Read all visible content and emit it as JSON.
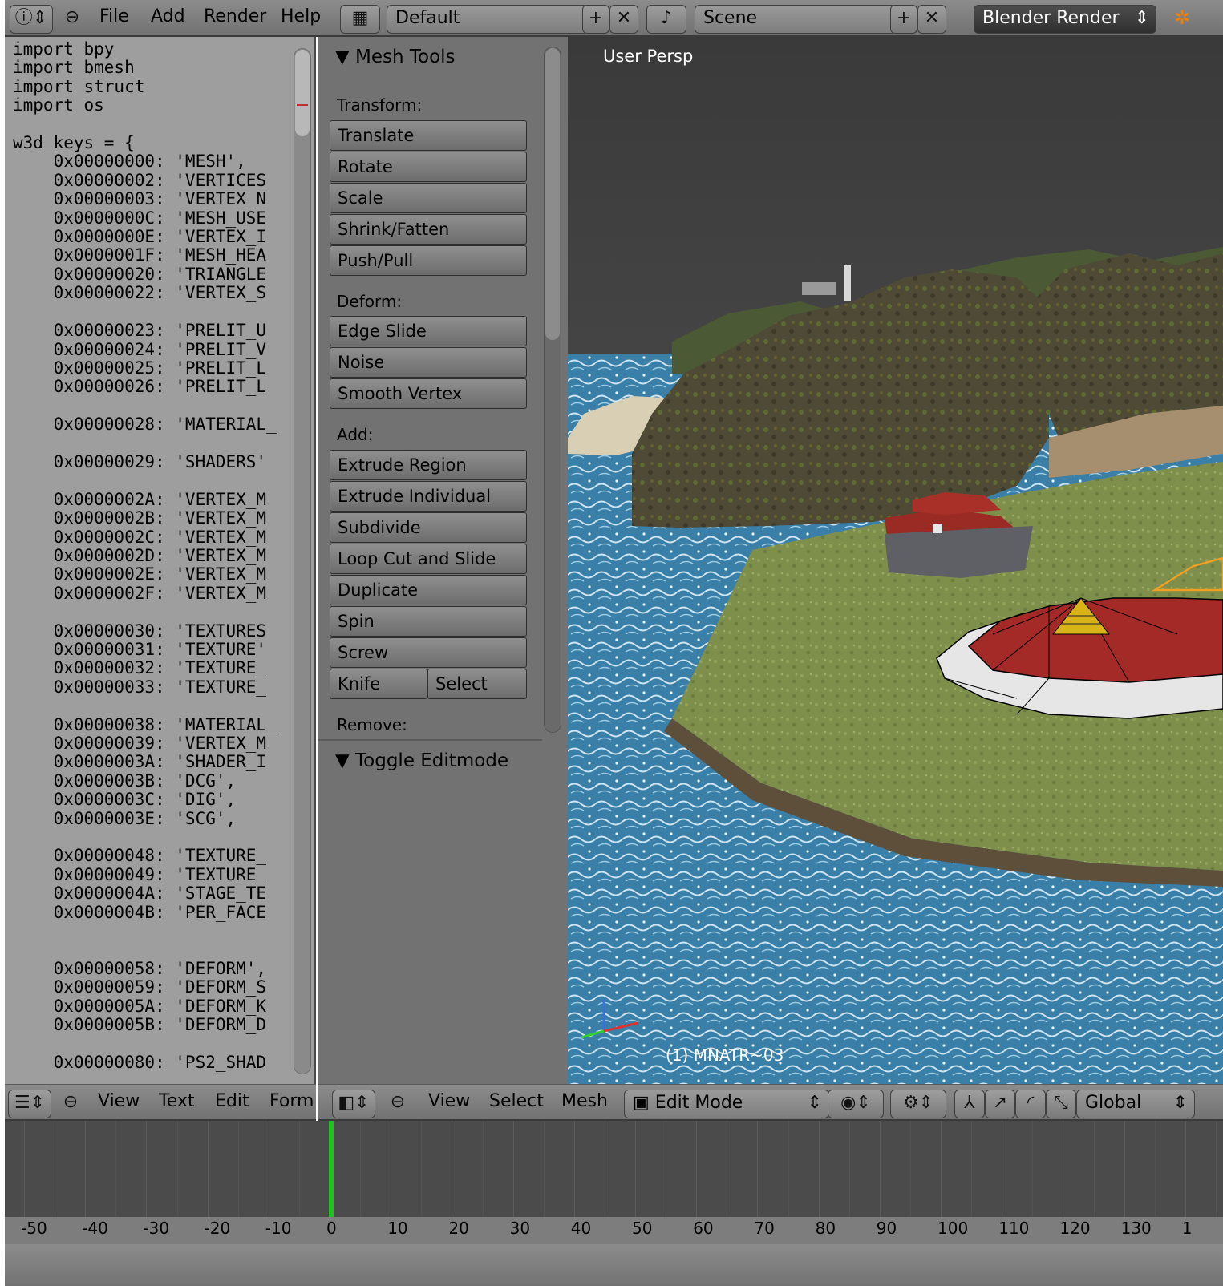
{
  "info_header": {
    "menus": [
      "File",
      "Add",
      "Render",
      "Help"
    ],
    "screen_layout": "Default",
    "scene": "Scene",
    "render_engine": "Blender Render"
  },
  "text_editor": {
    "code_lines": [
      "import bpy",
      "import bmesh",
      "import struct",
      "import os",
      "",
      "w3d_keys = {",
      "    0x00000000: 'MESH',",
      "    0x00000002: 'VERTICES",
      "    0x00000003: 'VERTEX_N",
      "    0x0000000C: 'MESH_USE",
      "    0x0000000E: 'VERTEX_I",
      "    0x0000001F: 'MESH_HEA",
      "    0x00000020: 'TRIANGLE",
      "    0x00000022: 'VERTEX_S",
      "",
      "    0x00000023: 'PRELIT_U",
      "    0x00000024: 'PRELIT_V",
      "    0x00000025: 'PRELIT_L",
      "    0x00000026: 'PRELIT_L",
      "",
      "    0x00000028: 'MATERIAL_",
      "",
      "    0x00000029: 'SHADERS'",
      "",
      "    0x0000002A: 'VERTEX_M",
      "    0x0000002B: 'VERTEX_M",
      "    0x0000002C: 'VERTEX_M",
      "    0x0000002D: 'VERTEX_M",
      "    0x0000002E: 'VERTEX_M",
      "    0x0000002F: 'VERTEX_M",
      "",
      "    0x00000030: 'TEXTURES",
      "    0x00000031: 'TEXTURE'",
      "    0x00000032: 'TEXTURE_",
      "    0x00000033: 'TEXTURE_",
      "",
      "    0x00000038: 'MATERIAL_",
      "    0x00000039: 'VERTEX_M",
      "    0x0000003A: 'SHADER_I",
      "    0x0000003B: 'DCG',",
      "    0x0000003C: 'DIG',",
      "    0x0000003E: 'SCG',",
      "",
      "    0x00000048: 'TEXTURE_",
      "    0x00000049: 'TEXTURE_",
      "    0x0000004A: 'STAGE_TE",
      "    0x0000004B: 'PER_FACE",
      "",
      "",
      "    0x00000058: 'DEFORM',",
      "    0x00000059: 'DEFORM_S",
      "    0x0000005A: 'DEFORM_K",
      "    0x0000005B: 'DEFORM_D",
      "",
      "    0x00000080: 'PS2_SHAD"
    ],
    "header_menus": [
      "View",
      "Text",
      "Edit",
      "Form"
    ]
  },
  "tool_shelf": {
    "panel_title": "Mesh Tools",
    "transform_label": "Transform:",
    "transform_buttons": [
      "Translate",
      "Rotate",
      "Scale",
      "Shrink/Fatten",
      "Push/Pull"
    ],
    "deform_label": "Deform:",
    "deform_buttons": [
      "Edge Slide",
      "Noise",
      "Smooth Vertex"
    ],
    "add_label": "Add:",
    "add_buttons": [
      "Extrude Region",
      "Extrude Individual",
      "Subdivide",
      "Loop Cut and Slide",
      "Duplicate",
      "Spin",
      "Screw"
    ],
    "knife_label": "Knife",
    "select_label": "Select",
    "remove_label": "Remove:",
    "toggle_panel_title": "Toggle Editmode"
  },
  "viewport": {
    "view_name": "User Persp",
    "object_label": "(1) MNATR~03",
    "header_menus": [
      "View",
      "Select",
      "Mesh"
    ],
    "mode": "Edit Mode",
    "orientation": "Global"
  },
  "timeline": {
    "ticks": [
      "-50",
      "-40",
      "-30",
      "-20",
      "-10",
      "0",
      "10",
      "20",
      "30",
      "40",
      "50",
      "60",
      "70",
      "80",
      "90",
      "100",
      "110",
      "120",
      "130",
      "1"
    ],
    "current_frame": 0
  },
  "colors": {
    "header_bg": "#7f7f7f",
    "panel_bg": "#727272",
    "text_editor_bg": "#9e9e9e",
    "timeline_bg": "#4b4b4b",
    "frame_cursor": "#22c020",
    "water": "#3a7fa8",
    "grass": "#7e8f4c",
    "selection_orange": "#f0a020"
  }
}
